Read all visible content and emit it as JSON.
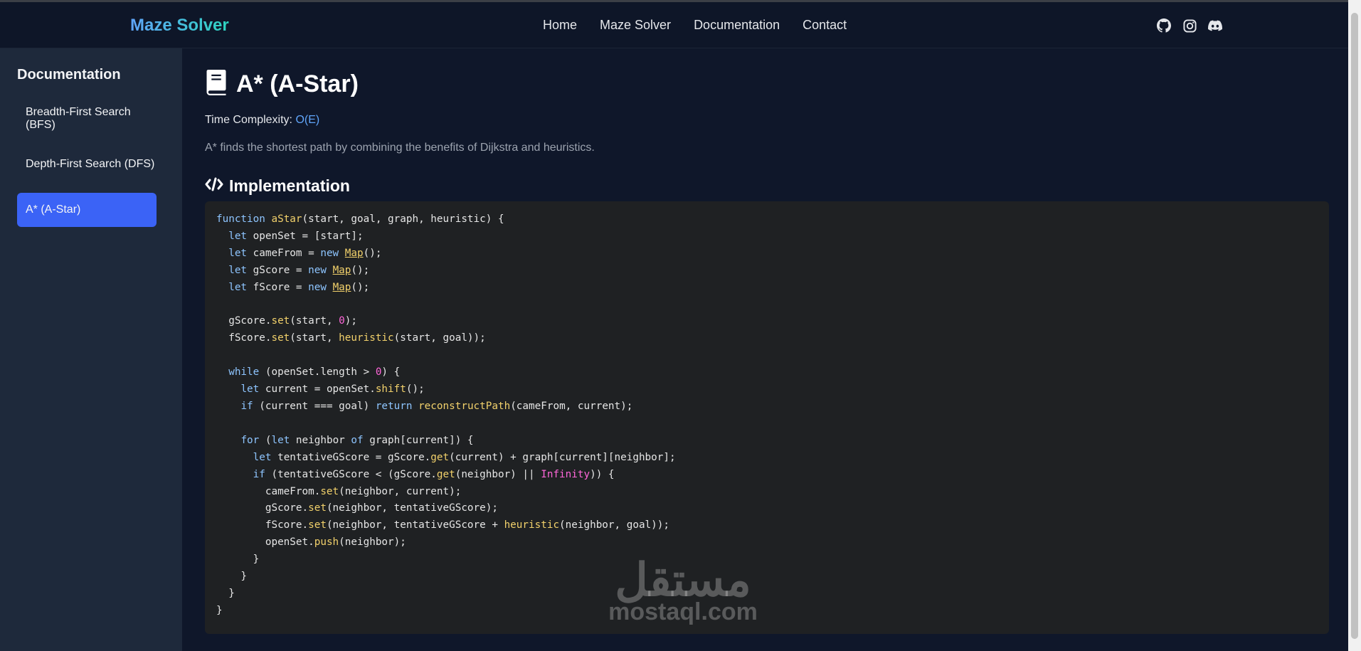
{
  "brand": "Maze Solver",
  "nav": [
    "Home",
    "Maze Solver",
    "Documentation",
    "Contact"
  ],
  "social_icons": [
    "github-icon",
    "instagram-icon",
    "discord-icon"
  ],
  "sidebar": {
    "title": "Documentation",
    "items": [
      {
        "label": "Breadth-First Search (BFS)",
        "active": false
      },
      {
        "label": "Depth-First Search (DFS)",
        "active": false
      },
      {
        "label": "A* (A-Star)",
        "active": true
      }
    ]
  },
  "main": {
    "title_icon": "book-icon",
    "title": "A* (A-Star)",
    "complexity_label": "Time Complexity:",
    "complexity_value": "O(E)",
    "description": "A* finds the shortest path by combining the benefits of Dijkstra and heuristics.",
    "section_icon": "code-icon",
    "section_title": "Implementation",
    "code": "function aStar(start, goal, graph, heuristic) {\n  let openSet = [start];\n  let cameFrom = new Map();\n  let gScore = new Map();\n  let fScore = new Map();\n\n  gScore.set(start, 0);\n  fScore.set(start, heuristic(start, goal));\n\n  while (openSet.length > 0) {\n    let current = openSet.shift();\n    if (current === goal) return reconstructPath(cameFrom, current);\n\n    for (let neighbor of graph[current]) {\n      let tentativeGScore = gScore.get(current) + graph[current][neighbor];\n      if (tentativeGScore < (gScore.get(neighbor) || Infinity)) {\n        cameFrom.set(neighbor, current);\n        gScore.set(neighbor, tentativeGScore);\n        fScore.set(neighbor, tentativeGScore + heuristic(neighbor, goal));\n        openSet.push(neighbor);\n      }\n    }\n  }\n}"
  },
  "watermark": {
    "arabic": "مستقل",
    "latin": "mostaql.com"
  },
  "colors": {
    "accent": "#3b63f6",
    "link": "#60a5fa",
    "background": "#0f172a",
    "sidebar": "#1e293b",
    "code_bg": "#1f2123"
  }
}
